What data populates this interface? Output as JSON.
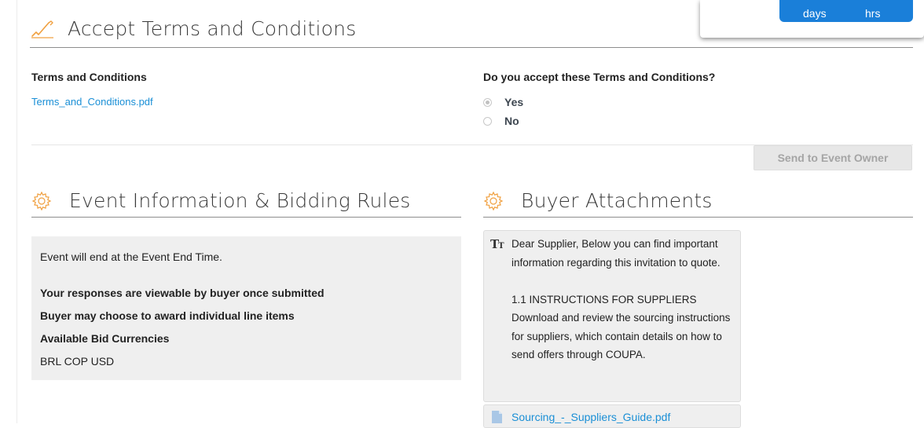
{
  "timer": {
    "days_label": "days",
    "hrs_label": "hrs"
  },
  "terms_section": {
    "title": "Accept Terms and Conditions",
    "terms_label": "Terms and Conditions",
    "terms_file": "Terms_and_Conditions.pdf",
    "question": "Do you accept these Terms and Conditions?",
    "options": [
      {
        "label": "Yes",
        "selected": true
      },
      {
        "label": "No",
        "selected": false
      }
    ],
    "send_button": "Send to Event Owner"
  },
  "event_section": {
    "title": "Event Information & Bidding Rules",
    "lines": [
      "Event will end at the Event End Time.",
      "Your responses are viewable by buyer once submitted",
      "Buyer may choose to award individual line items",
      "Available Bid Currencies",
      "BRL COP USD"
    ]
  },
  "attachments_section": {
    "title": "Buyer Attachments",
    "note": "Dear Supplier, Below you can find important information regarding this invitation to quote.\n\n1.1 INSTRUCTIONS FOR SUPPLIERS Download and review the sourcing instructions for suppliers, which contain details on how to send offers through COUPA.",
    "file": "Sourcing_-_Suppliers_Guide.pdf"
  },
  "colors": {
    "accent_orange": "#f0a040",
    "link_blue": "#1a8fd6",
    "timer_blue": "#1a7fd9"
  }
}
